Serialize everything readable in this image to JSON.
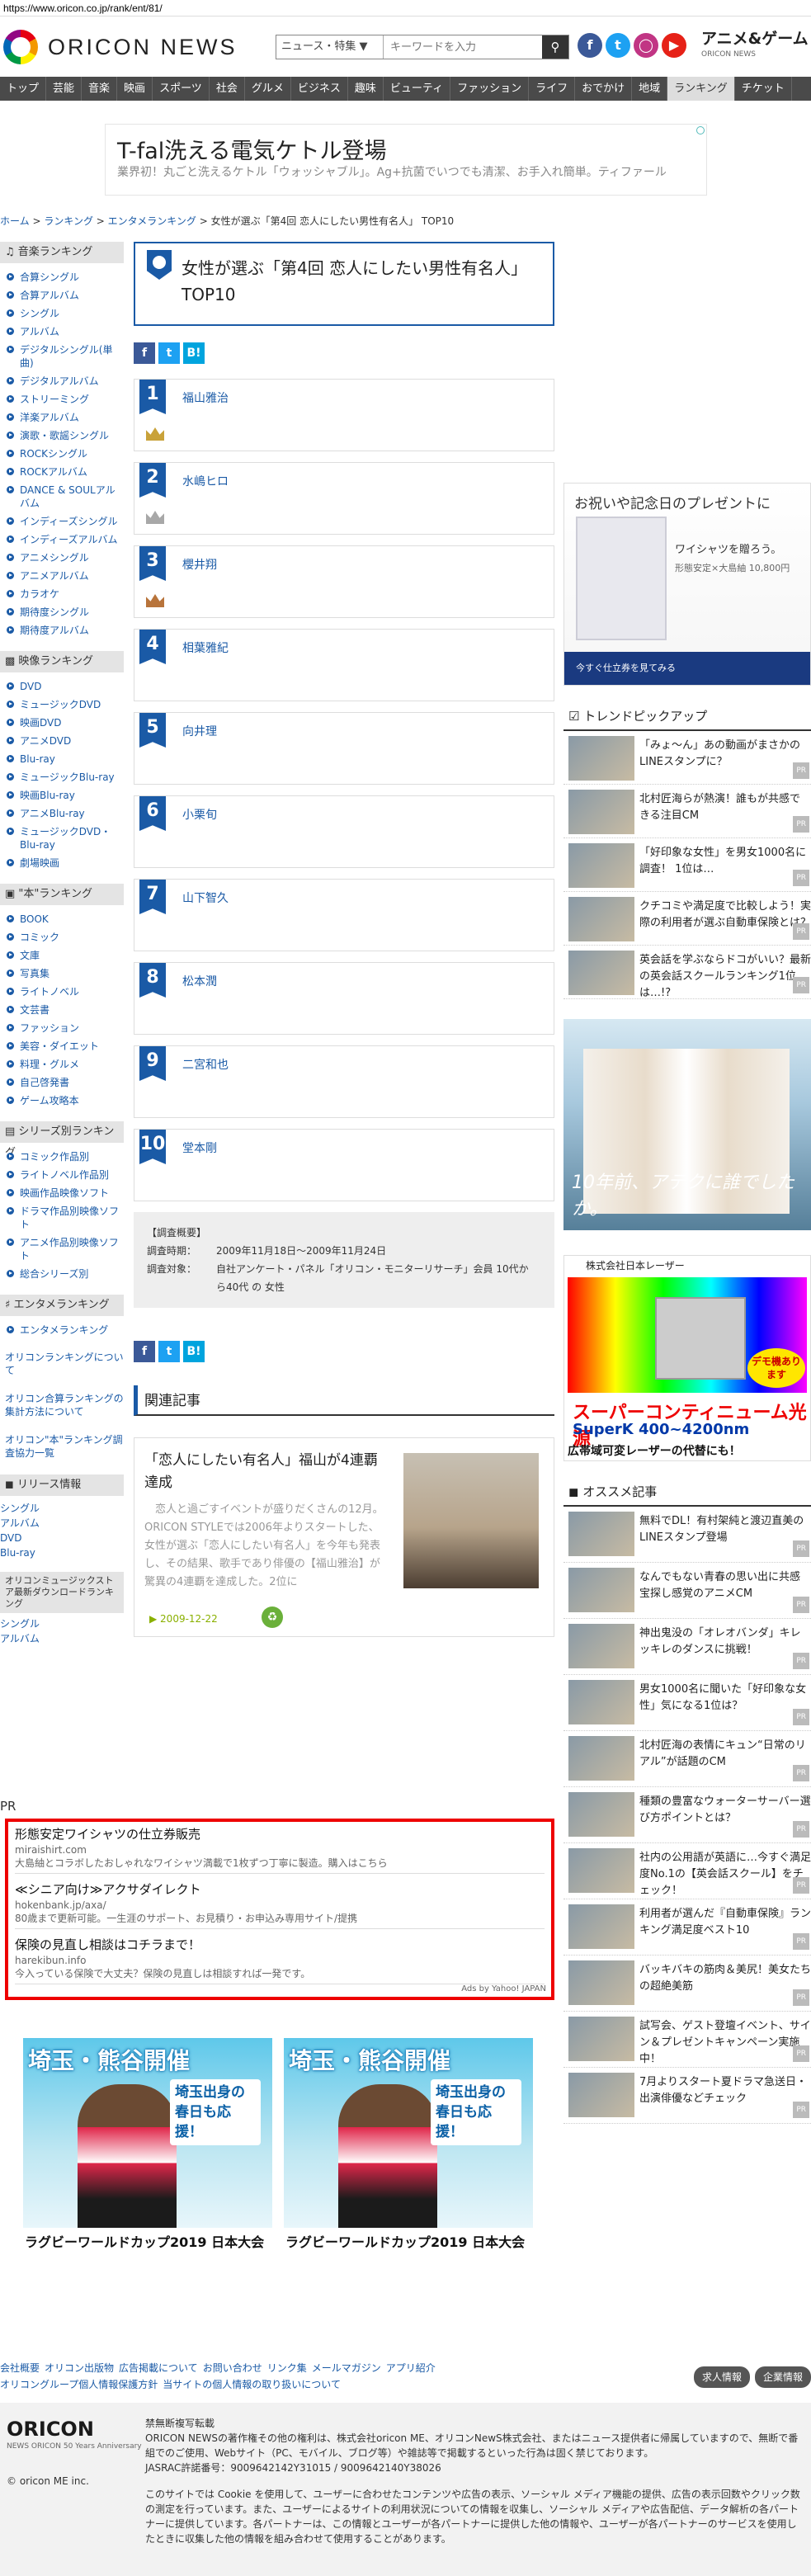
{
  "url": "https://www.oricon.co.jp/rank/ent/81/",
  "header": {
    "logo": "ORICON NEWS",
    "search_select": "ニュース・特集 ▼",
    "search_placeholder": "キーワードを入力",
    "search_icon": "magnifier-icon",
    "social": [
      "f",
      "t",
      "ig",
      "yt"
    ],
    "anime_logo": "アニメ&ゲーム",
    "anime_sub": "ORICON NEWS"
  },
  "nav": [
    "トップ",
    "芸能",
    "音楽",
    "映画",
    "スポーツ",
    "社会",
    "グルメ",
    "ビジネス",
    "趣味",
    "ビューティ",
    "ファッション",
    "ライフ",
    "おでかけ",
    "地域",
    "ランキング",
    "チケット"
  ],
  "nav_active": "ランキング",
  "ad_banner": {
    "title": "T-fal洗える電気ケトル登場",
    "desc": "業界初！丸ごと洗えるケトル「ウォッシャブル」。Ag+抗菌でいつでも清潔、お手入れ簡単。ティファール"
  },
  "breadcrumb": [
    "ホーム",
    "ランキング",
    "エンタメランキング",
    "女性が選ぶ「第4回 恋人にしたい男性有名人」 TOP10"
  ],
  "sidebar": {
    "music_head": "音楽ランキング",
    "music": [
      "合算シングル",
      "合算アルバム",
      "シングル",
      "アルバム",
      "デジタルシングル(単曲)",
      "デジタルアルバム",
      "ストリーミング",
      "洋楽アルバム",
      "演歌・歌謡シングル",
      "ROCKシングル",
      "ROCKアルバム",
      "DANCE & SOULアルバム",
      "インディーズシングル",
      "インディーズアルバム",
      "アニメシングル",
      "アニメアルバム",
      "カラオケ",
      "期待度シングル",
      "期待度アルバム"
    ],
    "video_head": "映像ランキング",
    "video": [
      "DVD",
      "ミュージックDVD",
      "映画DVD",
      "アニメDVD",
      "Blu-ray",
      "ミュージックBlu-ray",
      "映画Blu-ray",
      "アニメBlu-ray",
      "ミュージックDVD・Blu-ray",
      "劇場映画"
    ],
    "book_head": "\"本\"ランキング",
    "book": [
      "BOOK",
      "コミック",
      "文庫",
      "写真集",
      "ライトノベル",
      "文芸書",
      "ファッション",
      "美容・ダイエット",
      "料理・グルメ",
      "自己啓発書",
      "ゲーム攻略本"
    ],
    "series_head": "シリーズ別ランキング",
    "series": [
      "コミック作品別",
      "ライトノベル作品別",
      "映画作品映像ソフト",
      "ドラマ作品別映像ソフト",
      "アニメ作品別映像ソフト",
      "総合シリーズ別"
    ],
    "ent_head": "エンタメランキング",
    "ent": [
      "エンタメランキング"
    ],
    "links": [
      "オリコンランキングについて",
      "オリコン合算ランキングの集計方法について",
      "オリコン\"本\"ランキング調査協力一覧"
    ],
    "release_head": "リリース情報",
    "release": [
      "シングル",
      "アルバム",
      "DVD",
      "Blu-ray"
    ],
    "store_head": "オリコンミュージックストア最新ダウンロードランキング",
    "store": [
      "シングル",
      "アルバム"
    ]
  },
  "main": {
    "title": "女性が選ぶ「第4回 恋人にしたい男性有名人」 TOP10",
    "share": [
      "f",
      "t",
      "B!"
    ],
    "ranks": [
      {
        "num": "1",
        "name": "福山雅治",
        "crown": "gold"
      },
      {
        "num": "2",
        "name": "水嶋ヒロ",
        "crown": "silver"
      },
      {
        "num": "3",
        "name": "櫻井翔",
        "crown": "bronze"
      },
      {
        "num": "4",
        "name": "相葉雅紀",
        "crown": ""
      },
      {
        "num": "5",
        "name": "向井理",
        "crown": ""
      },
      {
        "num": "6",
        "name": "小栗旬",
        "crown": ""
      },
      {
        "num": "7",
        "name": "山下智久",
        "crown": ""
      },
      {
        "num": "8",
        "name": "松本潤",
        "crown": ""
      },
      {
        "num": "9",
        "name": "二宮和也",
        "crown": ""
      },
      {
        "num": "10",
        "name": "堂本剛",
        "crown": ""
      }
    ],
    "survey_title": "【調査概要】",
    "survey_period_label": "調査時期：",
    "survey_period": "2009年11月18日〜2009年11月24日",
    "survey_target_label": "調査対象：",
    "survey_target": "自社アンケート・パネル「オリコン・モニターリサーチ」会員 10代から40代 の 女性",
    "related_head": "関連記事",
    "related": {
      "title": "「恋人にしたい有名人」福山が4連覇達成",
      "body": "恋人と過ごすイベントが盛りだくさんの12月。ORICON STYLEでは2006年よりスタートした、女性が選ぶ「恋人にしたい有名人」を今年も発表し、その結果、歌手であり俳優の【福山雅治】が驚異の4連覇を達成した。2位に",
      "date": "2009-12-22"
    }
  },
  "pr": {
    "label": "PR",
    "items": [
      {
        "t": "形態安定ワイシャツの仕立券販売",
        "u": "miraishirt.com",
        "d": "大島紬とコラボしたおしゃれなワイシャツ満載で1枚ずつ丁寧に製造。購入はこちら"
      },
      {
        "t": "≪シニア向け≫アクサダイレクト",
        "u": "hokenbank.jp/axa/",
        "d": "80歳まで更新可能。一生涯のサポート、お見積り・お申込み専用サイト/提携"
      },
      {
        "t": "保険の見直し相談はコチラまで！",
        "u": "harekibun.info",
        "d": "今入っている保険で大丈夫？保険の見直しは相談すれば一発です。"
      }
    ],
    "foot": "Ads by Yahoo! JAPAN"
  },
  "banners": [
    {
      "title": "埼玉・熊谷開催",
      "sub": "埼玉出身の春日も応援！",
      "cap": "ラグビーワールドカップ2019 日本大会"
    },
    {
      "title": "埼玉・熊谷開催",
      "sub": "埼玉出身の春日も応援！",
      "cap": "ラグビーワールドカップ2019 日本大会"
    }
  ],
  "right": {
    "shirt_ad": {
      "head": "お祝いや記念日のプレゼントに",
      "txt": "ワイシャツを贈ろう。",
      "sub": "形態安定×大島紬 10,800円",
      "foot": "今すぐ仕立券を見てみる"
    },
    "trend_head": "トレンドピックアップ",
    "trend": [
      "「みょ〜ん」あの動画がまさかのLINEスタンプに？",
      "北村匠海らが熱演！誰もが共感できる注目CM",
      "「好印象な女性」を男女1000名に調査！ 1位は…",
      "クチコミや満足度で比較しよう！実際の利用者が選ぶ自動車保険とは？",
      "英会話を学ぶならドコがいい？最新の英会話スクールランキング1位は…!?"
    ],
    "photo_ad_cap": "10年前、アテクに誰でしたか。",
    "laser": {
      "top": "株式会社日本レーザー",
      "demo": "デモ機あります",
      "h1": "スーパーコンティニューム光源",
      "h2": "SuperK 400~4200nm",
      "h3": "広帯域可変レーザーの代替にも！"
    },
    "rec_head": "オススメ記事",
    "rec": [
      "無料でDL！有村架純と渡辺直美のLINEスタンプ登場",
      "なんでもない青春の思い出に共感 宝探し感覚のアニメCM",
      "神出鬼没の「オレオバンダ」キレッキレのダンスに挑戦！",
      "男女1000名に聞いた「好印象な女性」気になる1位は？",
      "北村匠海の表情にキュン“日常のリアル”が話題のCM",
      "種類の豊富なウォーターサーバー選び方ポイントとは？",
      "社内の公用語が英語に…今すぐ満足度No.1の【英会話スクール】をチェック！",
      "利用者が選んだ『自動車保険』ランキング満足度ベスト10",
      "バッキバキの筋肉＆美尻！美女たちの超絶美筋",
      "試写会、ゲスト登壇イベント、サイン＆プレゼントキャンペーン実施中！",
      "7月よりスタート夏ドラマ急送日・出演俳優などチェック"
    ]
  },
  "footer": {
    "nav1": [
      "会社概要",
      "オリコン出版物",
      "広告掲載について",
      "お問い合わせ",
      "リンク集",
      "メールマガジン",
      "アプリ紹介"
    ],
    "nav2": [
      "オリコングループ個人情報保護方針",
      "当サイトの個人情報の取り扱いについて"
    ],
    "btns": [
      "求人情報",
      "企業情報"
    ],
    "logo": "ORICON",
    "logo_sub": "NEWS ORICON 50 Years Anniversary",
    "copy": "© oricon ME inc.",
    "text1_title": "禁無断複写転載",
    "text1": "ORICON NEWSの著作権その他の権利は、株式会社oricon ME、オリコンNewS株式会社、またはニュース提供者に帰属していますので、無断で番組でのご使用、Webサイト（PC、モバイル、ブログ等）や雑誌等で掲載するといった行為は固く禁じております。",
    "text1b": "JASRAC許諾番号：9009642142Y31015 / 9009642140Y38026",
    "text2": "このサイトでは Cookie を使用して、ユーザーに合わせたコンテンツや広告の表示、ソーシャル メディア機能の提供、広告の表示回数やクリック数の測定を行っています。また、ユーザーによるサイトの利用状況についての情報を収集し、ソーシャル メディアや広告配信、データ解析の各パートナーに提供しています。各パートナーは、この情報とユーザーが各パートナーに提供した他の情報や、ユーザーが各パートナーのサービスを使用したときに収集した他の情報を組み合わせて使用することがあります。"
  }
}
